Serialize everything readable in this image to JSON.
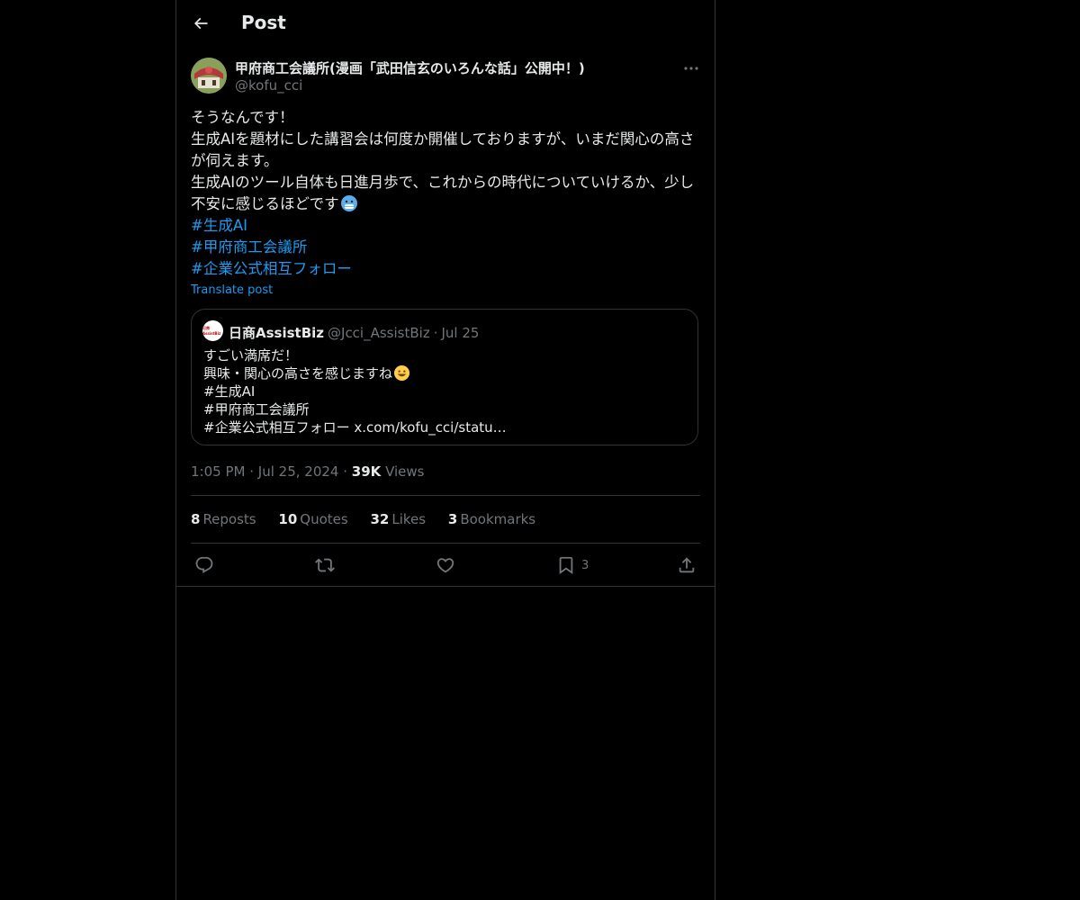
{
  "header": {
    "title": "Post"
  },
  "author": {
    "name": "甲府商工会議所(漫画「武田信玄のいろんな話」公開中！)",
    "handle": "@kofu_cci"
  },
  "post": {
    "lines": [
      "そうなんです！",
      "生成AIを題材にした講習会は何度か開催しておりますが、いまだ関心の高さが伺えます。",
      "生成AIのツール自体も日進月歩で、これからの時代についていけるか、少し不安に感じるほどです"
    ],
    "emoji": "cold-sweat-face",
    "hashtags": [
      "#生成AI",
      "#甲府商工会議所",
      "#企業公式相互フォロー"
    ],
    "translate_label": "Translate post"
  },
  "quote": {
    "avatar_text": "日商AssistBiz",
    "name": "日商AssistBiz",
    "handle": "@Jcci_AssistBiz",
    "date": "Jul 25",
    "lines": [
      "すごい満席だ！",
      "興味・関心の高さを感じますね",
      "#生成AI",
      "#甲府商工会議所",
      "#企業公式相互フォロー x.com/kofu_cci/statu…"
    ]
  },
  "meta": {
    "time": "1:05 PM",
    "date": "Jul 25, 2024",
    "views_count": "39K",
    "views_label": "Views"
  },
  "stats": {
    "reposts_count": "8",
    "reposts_label": "Reposts",
    "quotes_count": "10",
    "quotes_label": "Quotes",
    "likes_count": "32",
    "likes_label": "Likes",
    "bookmarks_count": "3",
    "bookmarks_label": "Bookmarks"
  },
  "actions": {
    "bookmark_count": "3"
  },
  "colors": {
    "background": "#000000",
    "link": "#1d9bf0",
    "border": "#2f3336",
    "muted": "#71767b"
  }
}
